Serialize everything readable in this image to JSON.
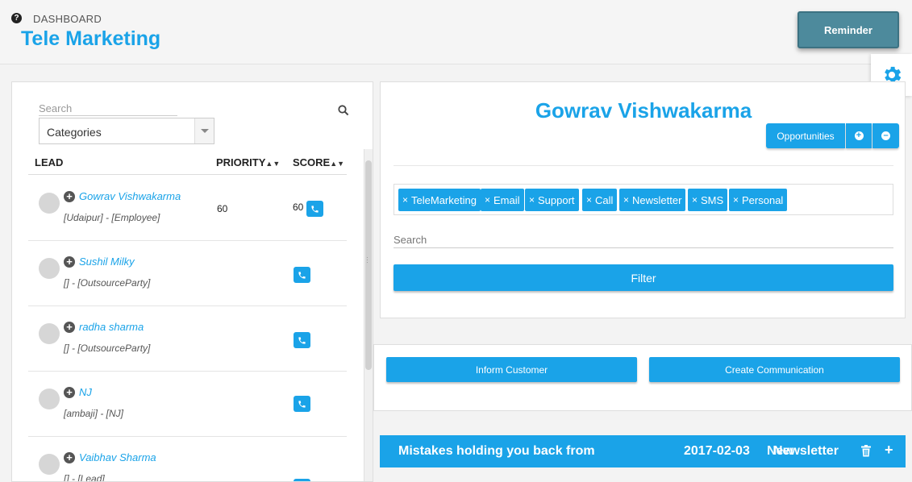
{
  "header": {
    "breadcrumb": "DASHBOARD",
    "title": "Tele Marketing",
    "reminder_label": "Reminder"
  },
  "leads_panel": {
    "search_placeholder": "Search",
    "category_select": "Categories",
    "columns": {
      "lead": "LEAD",
      "priority": "PRIORITY",
      "score": "SCORE"
    },
    "leads": [
      {
        "name": "Gowrav Vishwakarma",
        "sub": "[Udaipur] - [Employee]",
        "priority": "60",
        "score": "60"
      },
      {
        "name": "Sushil Milky",
        "sub": "[] - [OutsourceParty]",
        "priority": "",
        "score": ""
      },
      {
        "name": "radha sharma",
        "sub": "[] - [OutsourceParty]",
        "priority": "",
        "score": ""
      },
      {
        "name": "NJ",
        "sub": "[ambaji] - [NJ]",
        "priority": "",
        "score": ""
      },
      {
        "name": "Vaibhav Sharma",
        "sub": "[] - [Lead]",
        "priority": "",
        "score": ""
      }
    ]
  },
  "detail": {
    "name": "Gowrav Vishwakarma",
    "opportunities_label": "Opportunities",
    "tags": [
      "TeleMarketing",
      "Email",
      "Support",
      "Call",
      "Newsletter",
      "SMS",
      "Personal"
    ],
    "search_placeholder": "Search",
    "filter_label": "Filter"
  },
  "actions": {
    "inform_customer": "Inform Customer",
    "create_communication": "Create Communication"
  },
  "communication": {
    "title": "Mistakes holding you back from",
    "date": "2017-02-03",
    "status": "New",
    "type": "Newsletter"
  },
  "colors": {
    "accent": "#1aa3e8",
    "reminder": "#4d8a9c"
  }
}
